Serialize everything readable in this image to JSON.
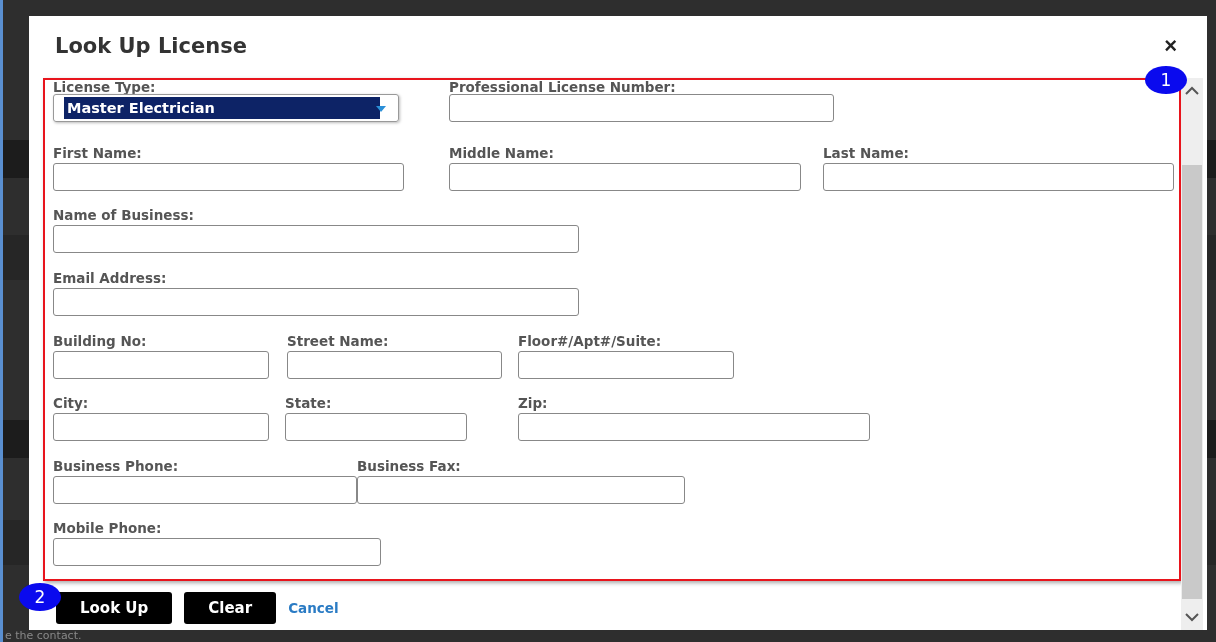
{
  "dialog": {
    "title": "Look Up License",
    "close": "×"
  },
  "form": {
    "rows": [
      [
        {
          "label": "License Type:",
          "kind": "select",
          "value": "Master Electrician"
        },
        {
          "label": "Professional License Number:",
          "kind": "text"
        }
      ],
      [
        {
          "label": "First Name:",
          "kind": "text"
        },
        {
          "label": "Middle Name:",
          "kind": "text"
        },
        {
          "label": "Last Name:",
          "kind": "text"
        }
      ],
      [
        {
          "label": "Name of Business:",
          "kind": "text"
        }
      ],
      [
        {
          "label": "Email Address:",
          "kind": "text"
        }
      ],
      [
        {
          "label": "Building No:",
          "kind": "text"
        },
        {
          "label": "Street Name:",
          "kind": "text"
        },
        {
          "label": "Floor#/Apt#/Suite:",
          "kind": "text"
        }
      ],
      [
        {
          "label": "City:",
          "kind": "text"
        },
        {
          "label": "State:",
          "kind": "text"
        },
        {
          "label": "Zip:",
          "kind": "text"
        }
      ],
      [
        {
          "label": "Business Phone:",
          "kind": "text"
        },
        {
          "label": "Business Fax:",
          "kind": "text"
        }
      ],
      [
        {
          "label": "Mobile Phone:",
          "kind": "text"
        }
      ]
    ]
  },
  "buttons": [
    {
      "label": "Look Up",
      "kind": "button"
    },
    {
      "label": "Clear",
      "kind": "button"
    },
    {
      "label": "Cancel",
      "kind": "link"
    }
  ],
  "callouts": [
    "1",
    "2"
  ],
  "background": {
    "footer_text": "e the contact."
  }
}
